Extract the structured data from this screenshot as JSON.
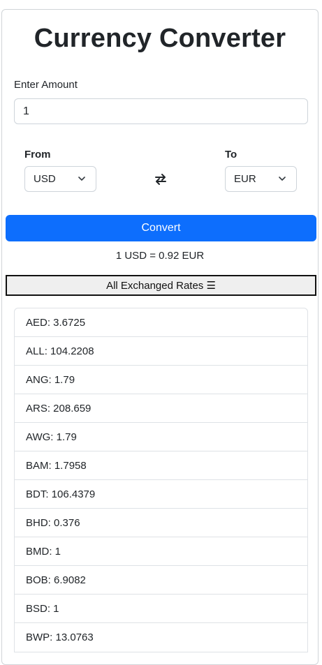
{
  "title": "Currency Converter",
  "amount": {
    "label": "Enter Amount",
    "value": "1"
  },
  "from": {
    "label": "From",
    "value": "USD"
  },
  "to": {
    "label": "To",
    "value": "EUR"
  },
  "convert_label": "Convert",
  "result": "1 USD = 0.92 EUR",
  "rates_button_label": "All Exchanged Rates ☰",
  "rates": [
    "AED: 3.6725",
    "ALL: 104.2208",
    "ANG: 1.79",
    "ARS: 208.659",
    "AWG: 1.79",
    "BAM: 1.7958",
    "BDT: 106.4379",
    "BHD: 0.376",
    "BMD: 1",
    "BOB: 6.9082",
    "BSD: 1",
    "BWP: 13.0763"
  ],
  "colors": {
    "primary": "#0d6efd",
    "text": "#212529",
    "border": "#dee2e6"
  }
}
